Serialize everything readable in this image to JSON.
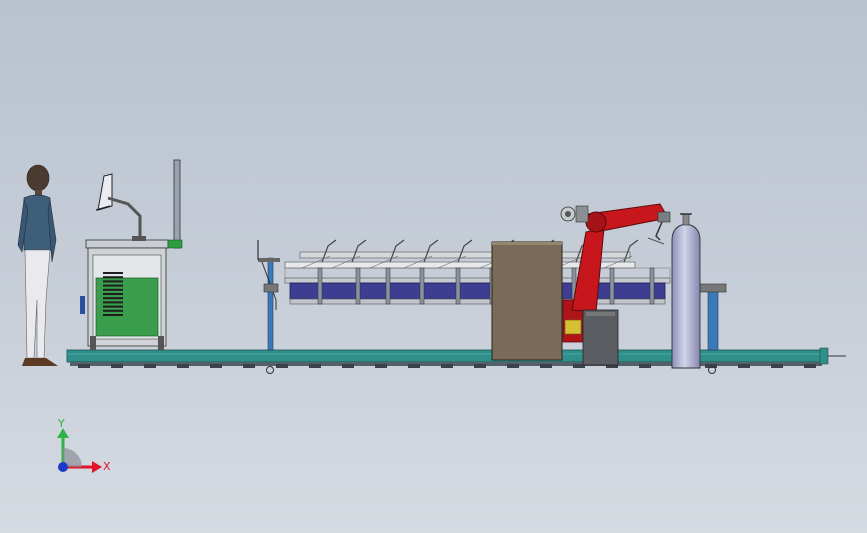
{
  "triad": {
    "x_label": "X",
    "y_label": "Y",
    "x_color": "#e0142b",
    "y_color": "#2fb34a",
    "z_color": "#1a3cc8"
  },
  "colors": {
    "background_top": "#b9c2cf",
    "background_bottom": "#d6dbe2",
    "base_rail": "#2f8f8a",
    "robot": "#c8161d",
    "cabinet_panel": "#3a9d4c",
    "cover_box": "#7a6b58",
    "gas_cylinder": "#b6b8d6",
    "conveyor_beam": "#3d3d92"
  }
}
